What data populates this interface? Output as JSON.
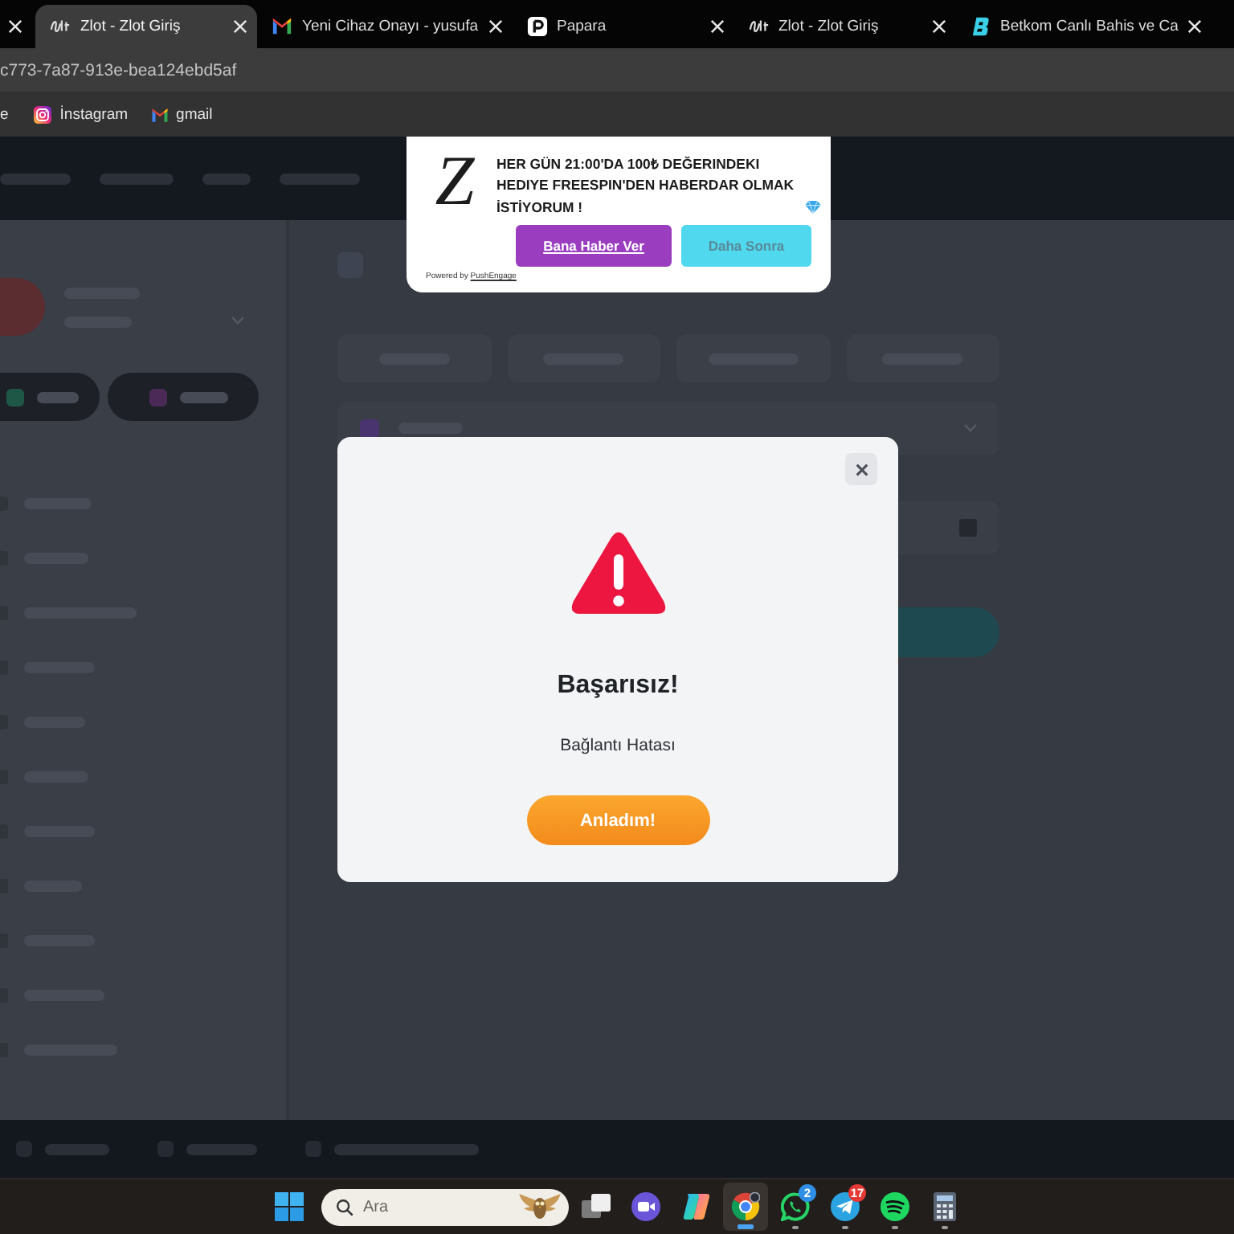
{
  "browser": {
    "tabs": [
      {
        "selected": false
      },
      {
        "title": "Zlot - Zlot Giriş",
        "kind": "script",
        "selected": true
      },
      {
        "title": "Yeni Cihaz Onayı - yusufa",
        "kind": "mail",
        "selected": false
      },
      {
        "title": "Papara",
        "kind": "tile",
        "selected": false
      },
      {
        "title": "Zlot - Zlot Giriş",
        "kind": "script",
        "selected": false
      },
      {
        "title": "Betkom Canlı Bahis ve Ca",
        "kind": "mark",
        "selected": false
      }
    ],
    "address": "c773-7a87-913e-bea124ebd5af",
    "bookmarks": [
      {
        "label": "e"
      },
      {
        "label": "İnstagram",
        "kind": "camera"
      },
      {
        "label": "gmail",
        "kind": "mail"
      }
    ]
  },
  "push_prompt": {
    "logo": "Z",
    "message": "HER GÜN 21:00'DA 100₺ DEĞERINDEKI HEDIYE FREESPIN'DEN HABERDAR OLMAK İSTİYORUM !",
    "buttons": [
      {
        "label": "Bana Haber Ver",
        "kind": "primary"
      },
      {
        "label": "Daha Sonra",
        "kind": "secondary"
      }
    ],
    "powered_by": {
      "text": "Powered by",
      "link": "PushEngage"
    }
  },
  "dialog": {
    "title": "Başarısız!",
    "message": "Bağlantı Hatası",
    "button": "Anladım!"
  },
  "taskbar": {
    "search_placeholder": "Ara",
    "apps": [
      {
        "kind": "stack",
        "running": false,
        "selected": false
      },
      {
        "kind": "camera",
        "running": false,
        "selected": false
      },
      {
        "kind": "swirl",
        "running": false,
        "selected": false
      },
      {
        "kind": "browser",
        "running": true,
        "selected": true
      },
      {
        "kind": "chat",
        "running": true,
        "selected": false,
        "badge": {
          "text": "2",
          "color": "#2f8fe6"
        }
      },
      {
        "kind": "plane",
        "running": true,
        "selected": false,
        "badge": {
          "text": "17",
          "color": "#e53935"
        }
      },
      {
        "kind": "music",
        "running": true,
        "selected": false
      },
      {
        "kind": "calculator",
        "running": true,
        "selected": false
      }
    ]
  }
}
